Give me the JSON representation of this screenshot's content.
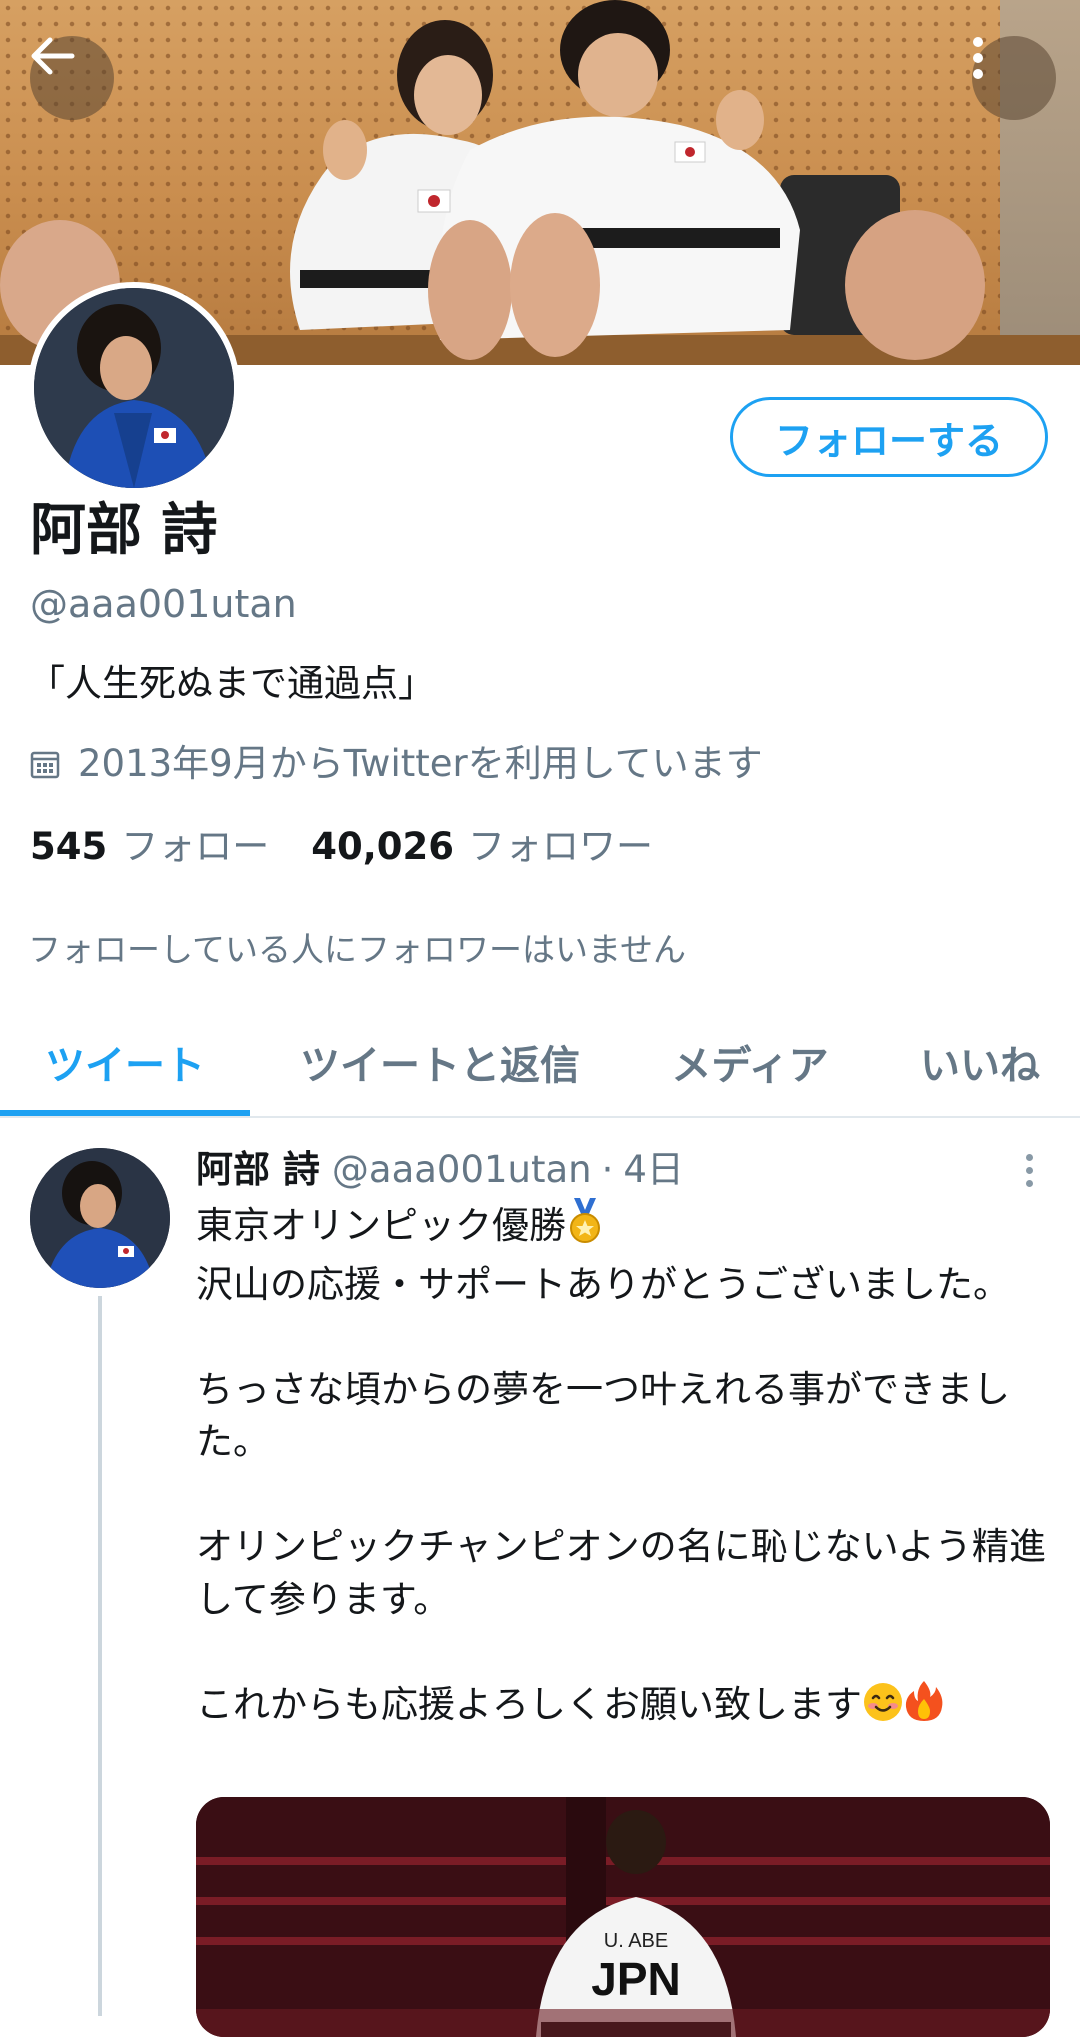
{
  "header": {
    "back_icon": "arrow-left-icon",
    "more_icon": "vertical-dots-icon"
  },
  "profile": {
    "display_name": "阿部 詩",
    "handle": "@aaa001utan",
    "bio": "「人生死ぬまで通過点」",
    "joined": "2013年9月からTwitterを利用しています",
    "joined_icon": "calendar-icon",
    "following_count": "545",
    "following_label": "フォロー",
    "followers_count": "40,026",
    "followers_label": "フォロワー",
    "followers_you_know": "フォローしている人にフォロワーはいません",
    "follow_button_label": "フォローする"
  },
  "colors": {
    "accent": "#1da1f2",
    "secondary_text": "#657786",
    "primary_text": "#14171a"
  },
  "tabs": [
    {
      "label": "ツイート",
      "active": true
    },
    {
      "label": "ツイートと返信",
      "active": false
    },
    {
      "label": "メディア",
      "active": false
    },
    {
      "label": "いいね",
      "active": false
    }
  ],
  "tweet": {
    "author_name": "阿部 詩",
    "author_handle": "@aaa001utan",
    "separator": "·",
    "time": "4日",
    "lines": {
      "l1": "東京オリンピック優勝",
      "l1_emoji": "medal-icon",
      "l2": "沢山の応援・サポートありがとうございました。",
      "l3": "ちっさな頃からの夢を一つ叶えれる事ができました。",
      "l4": "オリンピックチャンピオンの名に恥じないよう精進して参ります。",
      "l5": "これからも応援よろしくお願い致します",
      "l5_emoji": [
        "smiling-face-icon",
        "fire-icon"
      ]
    },
    "media": {
      "uniform_name": "U. ABE",
      "uniform_country": "JPN"
    }
  }
}
